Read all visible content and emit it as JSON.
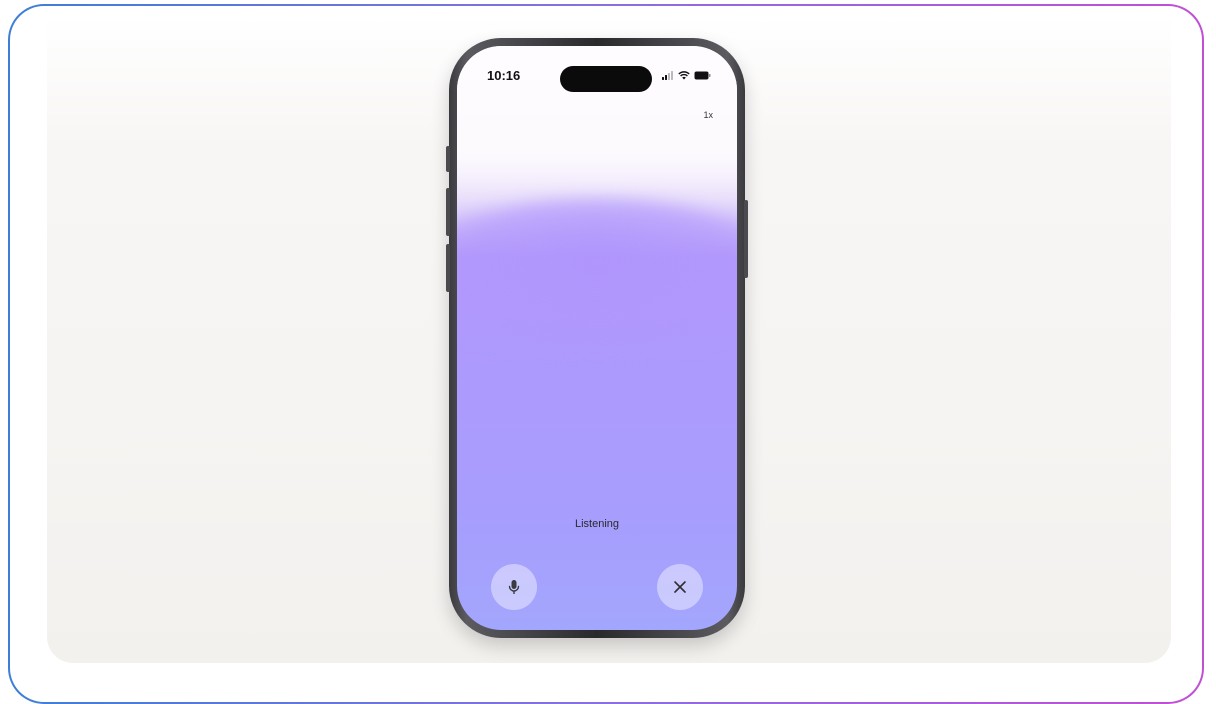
{
  "status_bar": {
    "time": "10:16"
  },
  "controls": {
    "speed": "1x"
  },
  "voice": {
    "status": "Listening"
  },
  "icons": {
    "signal": "signal-icon",
    "wifi": "wifi-icon",
    "battery": "battery-icon",
    "mic": "microphone-icon",
    "close": "close-icon"
  },
  "colors": {
    "frame_gradient_start": "#3d7fd6",
    "frame_gradient_end": "#c04fd6",
    "screen_gradient_top": "#fefcfe",
    "screen_gradient_mid": "#ae9afd",
    "screen_gradient_bottom": "#a3a6fd"
  }
}
